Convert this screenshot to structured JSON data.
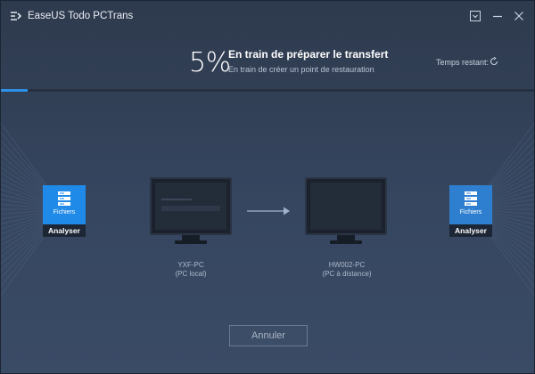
{
  "app": {
    "title": "EaseUS Todo PCTrans",
    "logo_icon": "easeus-logo-icon"
  },
  "window_controls": {
    "menu_icon": "dropdown-menu-icon",
    "minimize_icon": "minimize-icon",
    "close_icon": "close-icon"
  },
  "progress": {
    "percent_text": "5%",
    "percent_value": 5,
    "title": "En train de préparer le transfert",
    "subtitle": "En train de créer un point de restauration",
    "time_remaining_label": "Temps restant:",
    "bar_color": "#2d8fe6"
  },
  "source": {
    "card_label": "Fichiers",
    "button_label": "Analyser",
    "pc_name": "YXF-PC",
    "pc_role": "(PC local)"
  },
  "target": {
    "card_label": "Fichiers",
    "button_label": "Analyser",
    "pc_name": "HW002-PC",
    "pc_role": "(PC à distance)"
  },
  "actions": {
    "cancel_label": "Annuler"
  },
  "colors": {
    "accent": "#1f8ae8",
    "background": "#364660"
  }
}
